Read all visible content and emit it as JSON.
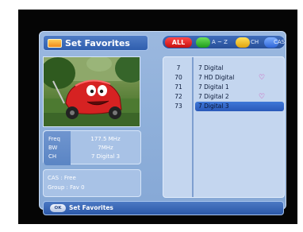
{
  "header": {
    "title": "Set Favorites",
    "title_icon": "favorites-icon"
  },
  "tabs": {
    "all": "ALL",
    "az": "A ~ Z",
    "ch": "CH",
    "cas": "CAS",
    "colors": {
      "all": "#e62a2a",
      "green": "#33b52a",
      "yellow": "#f2c02b",
      "blue": "#3f7be6"
    }
  },
  "info": {
    "freq_label": "Freq",
    "freq_value": "177.5 MHz",
    "bw_label": "BW",
    "bw_value": "7MHz",
    "ch_label": "CH",
    "ch_value": "7 Digital 3",
    "cas": "CAS : Free",
    "group": "Group : Fav 0"
  },
  "channels": [
    {
      "num": "7",
      "name": "7 Digital",
      "fav": ""
    },
    {
      "num": "70",
      "name": "7 HD Digital",
      "fav": "♡"
    },
    {
      "num": "71",
      "name": "7 Digital 1",
      "fav": ""
    },
    {
      "num": "72",
      "name": "7 Digital 2",
      "fav": "♡"
    },
    {
      "num": "73",
      "name": "7 Digital 3",
      "fav": ""
    }
  ],
  "selected_index": 4,
  "footer": {
    "ok_label": "OK",
    "action_label": "Set Favorites"
  }
}
